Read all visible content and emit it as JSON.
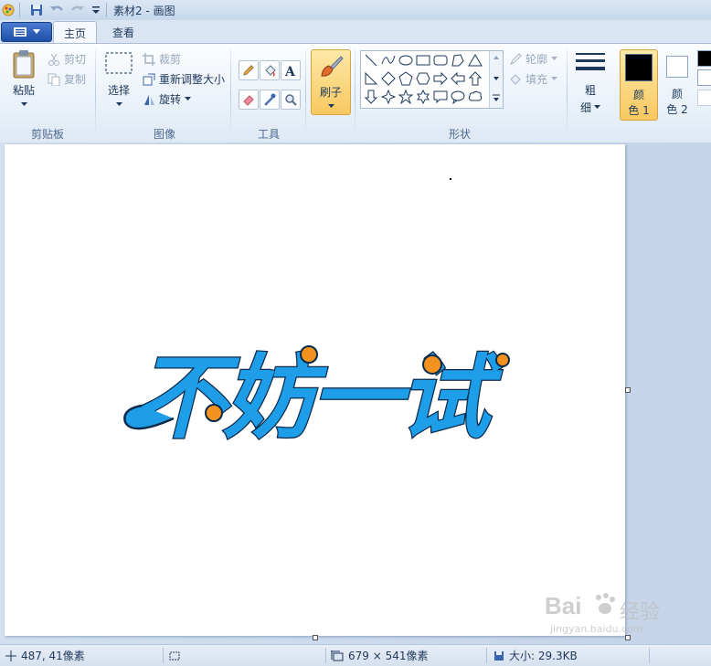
{
  "window": {
    "title": "素材2 - 画图"
  },
  "tabs": [
    {
      "label": "主页",
      "active": true
    },
    {
      "label": "查看",
      "active": false
    }
  ],
  "ribbon": {
    "clipboard": {
      "paste": "粘贴",
      "cut": "剪切",
      "copy": "复制",
      "label": "剪贴板"
    },
    "image": {
      "select": "选择",
      "crop": "裁剪",
      "resize": "重新调整大小",
      "rotate": "旋转",
      "label": "图像"
    },
    "tools": {
      "label": "工具"
    },
    "brushes": {
      "label": "刷子"
    },
    "shapes": {
      "outline": "轮廓",
      "fill": "填充",
      "label": "形状"
    },
    "size": {
      "line1": "粗",
      "line2": "细"
    },
    "colors": {
      "color1_line1": "颜",
      "color1_line2": "色 1",
      "color2_line1": "颜",
      "color2_line2": "色 2",
      "color1_value": "#000000",
      "color2_value": "#ffffff"
    }
  },
  "canvas": {
    "artwork_text": "不妨一试",
    "fill_color": "#1e9ee8",
    "dot_color": "#f3921f"
  },
  "status": {
    "cursor": "487, 41像素",
    "dimensions": "679 × 541像素",
    "filesize": "大小: 29.3KB"
  },
  "watermark": {
    "brand": "Bai",
    "brand_cn": "经验",
    "url": "jingyan.baidu.com"
  }
}
